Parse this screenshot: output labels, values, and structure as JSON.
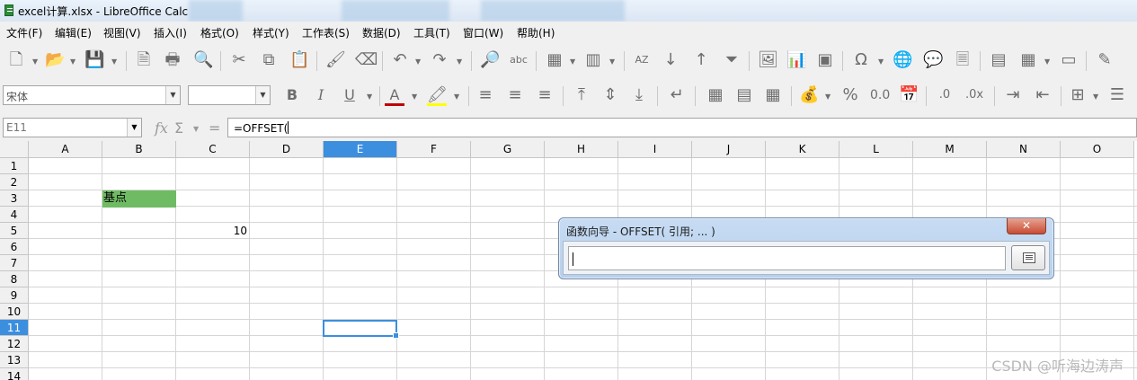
{
  "window": {
    "title": "excel计算.xlsx - LibreOffice Calc"
  },
  "menu": [
    "文件(F)",
    "编辑(E)",
    "视图(V)",
    "插入(I)",
    "格式(O)",
    "样式(Y)",
    "工作表(S)",
    "数据(D)",
    "工具(T)",
    "窗口(W)",
    "帮助(H)"
  ],
  "format_toolbar": {
    "font_name": "宋体",
    "font_size": ""
  },
  "formula_bar": {
    "name_box": "E11",
    "formula": "=OFFSET("
  },
  "columns": [
    "A",
    "B",
    "C",
    "D",
    "E",
    "F",
    "G",
    "H",
    "I",
    "J",
    "K",
    "L",
    "M",
    "N",
    "O"
  ],
  "rows": [
    "1",
    "2",
    "3",
    "4",
    "5",
    "6",
    "7",
    "8",
    "9",
    "10",
    "11",
    "12",
    "13",
    "14"
  ],
  "active_cell": {
    "column": "E",
    "row": "11"
  },
  "cells": {
    "B3": "基点",
    "C5": "10"
  },
  "colors": {
    "highlight_fill": "#6fbb63",
    "selection": "#3c8fdf"
  },
  "dialog": {
    "title": "函数向导  - OFFSET( 引用; ... )",
    "close_label": "✕",
    "input_value": ""
  },
  "watermark": "CSDN @听海边涛声"
}
